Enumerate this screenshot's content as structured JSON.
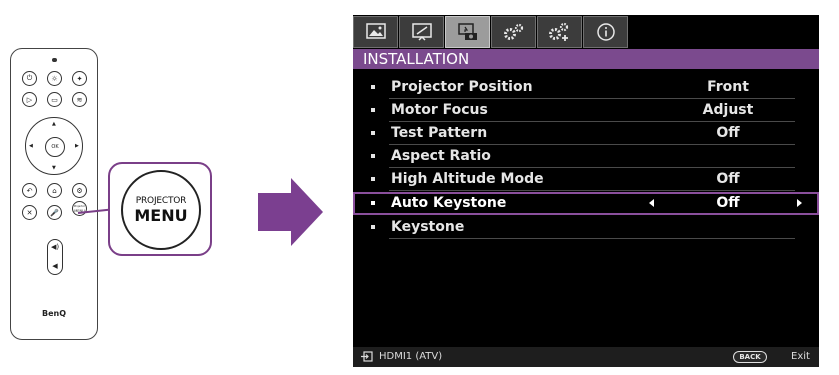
{
  "remote": {
    "brand": "BenQ",
    "ok_label": "OK",
    "callout_top": "PROJECTOR",
    "callout_bottom": "MENU",
    "small_menu_top": "Projector",
    "small_menu_bottom": "MENU"
  },
  "osd": {
    "tabs": [
      {
        "icon": "picture-icon"
      },
      {
        "icon": "display-icon"
      },
      {
        "icon": "installation-icon",
        "active": true
      },
      {
        "icon": "system-settings-icon"
      },
      {
        "icon": "advanced-settings-icon"
      },
      {
        "icon": "info-icon"
      }
    ],
    "section_title": "INSTALLATION",
    "rows": [
      {
        "label": "Projector Position",
        "value": "Front"
      },
      {
        "label": "Motor Focus",
        "value": "Adjust"
      },
      {
        "label": "Test Pattern",
        "value": "Off"
      },
      {
        "label": "Aspect Ratio",
        "value": ""
      },
      {
        "label": "High Altitude Mode",
        "value": "Off"
      },
      {
        "label": "Auto Keystone",
        "value": "Off",
        "selected": true
      },
      {
        "label": "Keystone",
        "value": ""
      }
    ],
    "footer": {
      "source": "HDMI1 (ATV)",
      "back_label": "BACK",
      "exit_label": "Exit"
    }
  },
  "colors": {
    "accent": "#7b4a8e",
    "arrow": "#7b3f90",
    "background": "#000000"
  }
}
